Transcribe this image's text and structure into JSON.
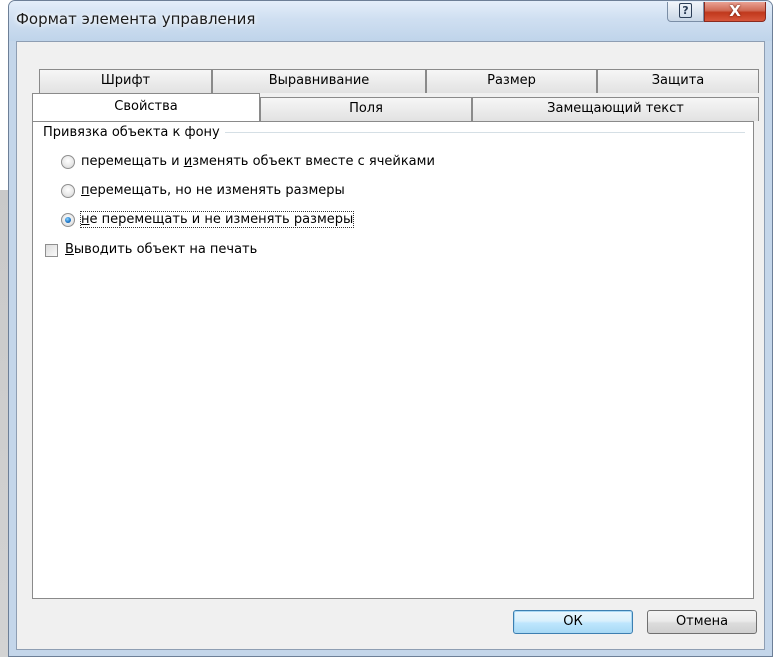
{
  "window": {
    "title": "Формат элемента управления",
    "help_glyph": "?",
    "close_glyph": "X"
  },
  "tabs": {
    "row1": [
      {
        "label": "Шрифт"
      },
      {
        "label": "Выравнивание"
      },
      {
        "label": "Размер"
      },
      {
        "label": "Защита"
      }
    ],
    "row2": [
      {
        "label": "Свойства",
        "active": true
      },
      {
        "label": "Поля"
      },
      {
        "label": "Замещающий текст"
      }
    ]
  },
  "properties": {
    "group_label": "Привязка объекта к фону",
    "options": [
      {
        "pre": "перемещать и ",
        "mn": "и",
        "post": "зменять объект вместе с ячейками",
        "checked": false
      },
      {
        "pre": "",
        "mn": "п",
        "post": "еремещать, но не изменять размеры",
        "checked": false
      },
      {
        "pre": "",
        "mn": "н",
        "post": "е перемещать и не изменять размеры",
        "checked": true
      }
    ],
    "print_checkbox": {
      "mn": "В",
      "post": "ыводить объект на печать",
      "checked": false
    }
  },
  "buttons": {
    "ok": "ОК",
    "cancel": "Отмена"
  },
  "colors": {
    "accent": "#3c7fb1",
    "close": "#c0381c",
    "frame": "#c4d6ea"
  }
}
